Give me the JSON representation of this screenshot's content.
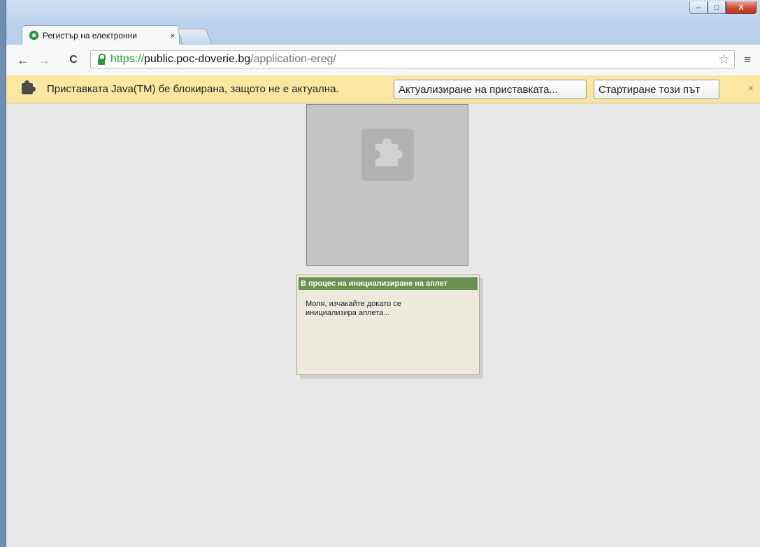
{
  "window": {
    "controls": {
      "minimize": "–",
      "maximize": "□",
      "close": "X"
    }
  },
  "tabs": [
    {
      "title": "Регистър на електронни",
      "close": "×"
    }
  ],
  "toolbar": {
    "back": "←",
    "forward": "→",
    "reload": "C",
    "url_scheme": "https://",
    "url_host": "public.poc-doverie.bg",
    "url_path": "/application-ereg/",
    "star": "☆",
    "menu": "≡"
  },
  "infobar": {
    "message": "Приставката Java(TM) бе блокирана, защото не е актуална.",
    "update_button": "Актуализиране на приставката...",
    "run_once_button": "Стартиране този път",
    "close": "×"
  },
  "applet_dialog": {
    "title": "В процес на инициализиране на аплет",
    "body": "Моля, изчакайте докато се инициализира аплета..."
  },
  "colors": {
    "infobar_bg": "#fbe7a2",
    "dialog_header": "#6a8f4f",
    "url_scheme": "#22a02e"
  }
}
